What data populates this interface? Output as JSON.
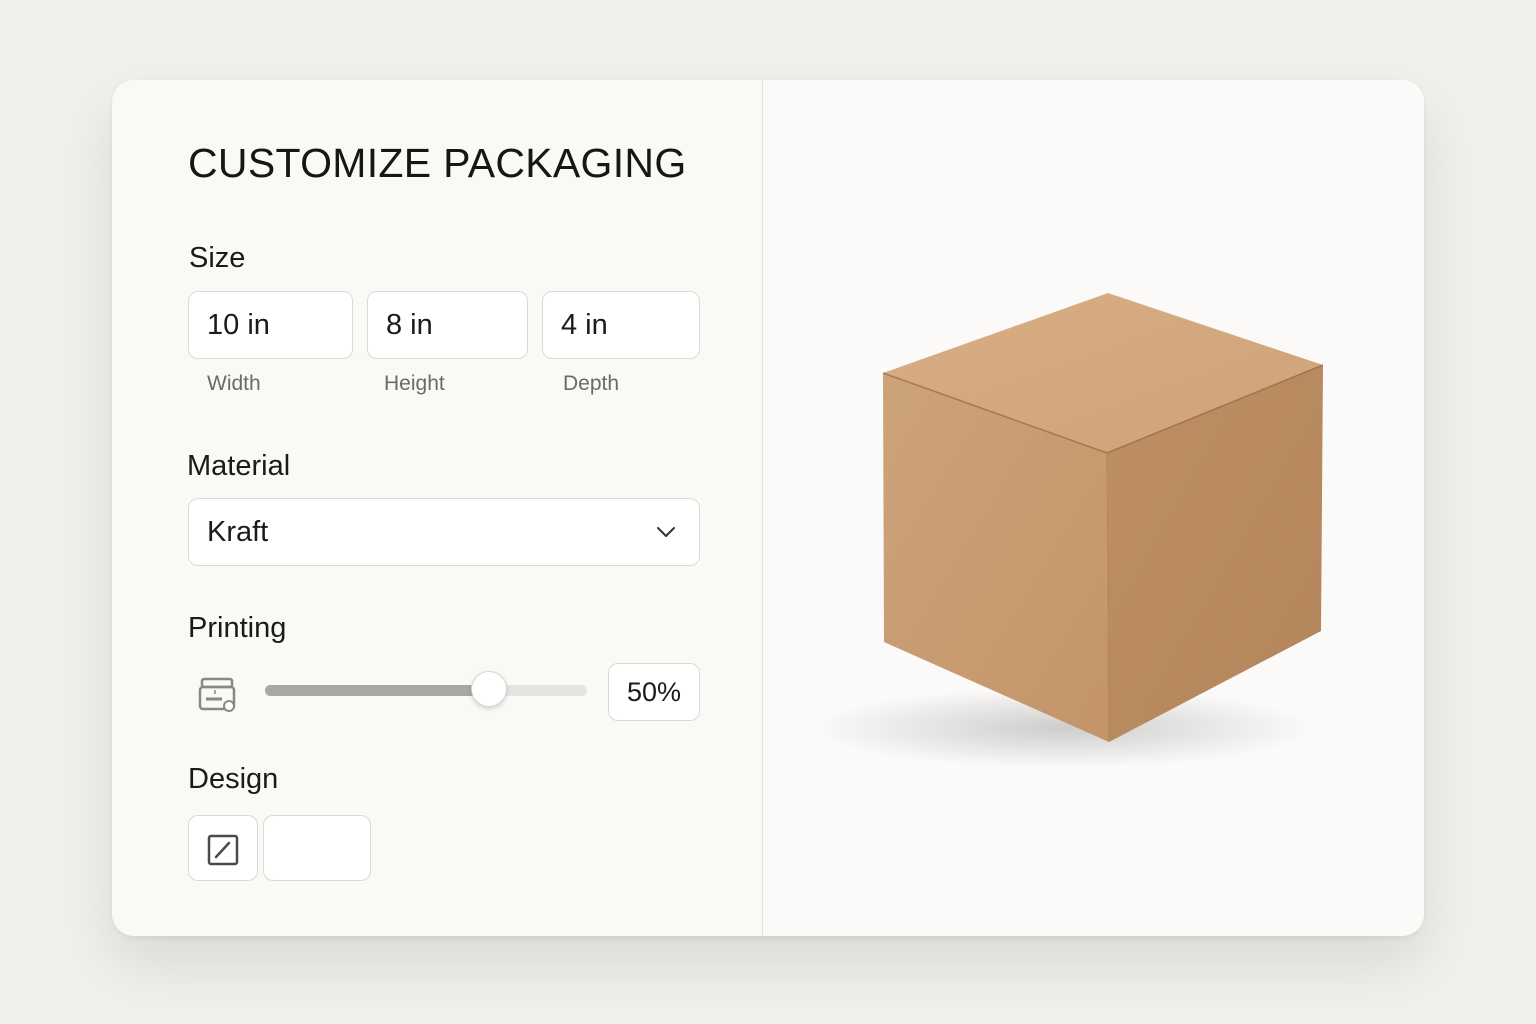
{
  "panel": {
    "title": "CUSTOMIZE PACKAGING"
  },
  "size": {
    "label": "Size",
    "width": {
      "value": "10 in",
      "caption": "Width"
    },
    "height": {
      "value": "8 in",
      "caption": "Height"
    },
    "depth": {
      "value": "4 in",
      "caption": "Depth"
    }
  },
  "material": {
    "label": "Material",
    "selected": "Kraft",
    "icon": "chevron-down-icon"
  },
  "printing": {
    "label": "Printing",
    "icon": "printer-icon",
    "level": 0.5,
    "value_text": "50%"
  },
  "design": {
    "label": "Design",
    "edit_icon": "edit-design-icon"
  },
  "preview": {
    "subject": "kraft box",
    "colors": {
      "box_top": "#cf9f72",
      "box_left": "#c89b70",
      "box_right": "#b98a5f"
    }
  },
  "colors": {
    "background": "#f2f0ec",
    "card": "#faf9f6",
    "border": "#dcdad5",
    "slider_fill": "#a9a7a3"
  }
}
